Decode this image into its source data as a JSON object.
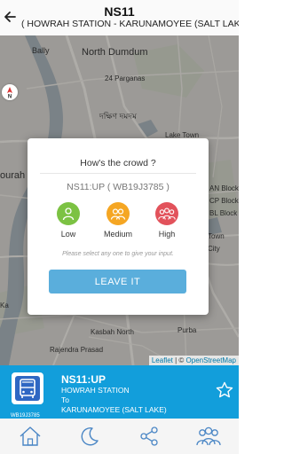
{
  "header": {
    "title": "NS11",
    "subtitle": "( HOWRAH STATION - KARUNAMOYEE (SALT LAKE)"
  },
  "map": {
    "labels": {
      "bally": "Bally",
      "north_dumdum": "North Dumdum",
      "twenty_four_parganas": "24 Parganas",
      "dakshin_dumdum_bn": "দক্ষিণ দমদম",
      "lake_town": "Lake Town",
      "ourah": "ourah",
      "an_block": "AN Block",
      "cp_block": "CP Block",
      "bl_block": "BL Block",
      "town": "Town",
      "city": "City",
      "kasbah_north": "Kasbah North",
      "purba": "Purba",
      "rajendra_prasad": "Rajendra Prasad",
      "ka": "Ka"
    },
    "compass_label": "N",
    "attribution": {
      "leaflet": "Leaflet",
      "separator": " | © ",
      "osm": "OpenStreetMap"
    }
  },
  "modal": {
    "title": "How's the crowd ?",
    "vehicle": "NS11:UP ( WB19J3785 )",
    "options": [
      {
        "label": "Low",
        "icon": "single-person-icon",
        "color": "#7cc243"
      },
      {
        "label": "Medium",
        "icon": "two-people-icon",
        "color": "#f5a623"
      },
      {
        "label": "High",
        "icon": "three-people-icon",
        "color": "#e2525b"
      }
    ],
    "hint": "Please select any one to give your input.",
    "leave_button": "LEAVE IT"
  },
  "info_bar": {
    "bus_icon": "bus-icon",
    "bus_reg": "WB19J3785",
    "route_code": "NS11:UP",
    "from": "HOWRAH STATION",
    "to_label": "To",
    "to": "KARUNAMOYEE (SALT LAKE)",
    "favorite_icon": "star-icon"
  },
  "bottom_nav": {
    "items": [
      {
        "icon": "home-icon"
      },
      {
        "icon": "moon-icon"
      },
      {
        "icon": "share-icon"
      },
      {
        "icon": "people-icon"
      }
    ]
  },
  "colors": {
    "accent": "#129edb",
    "button": "#5aaedc",
    "low": "#7cc243",
    "medium": "#f5a623",
    "high": "#e2525b"
  }
}
